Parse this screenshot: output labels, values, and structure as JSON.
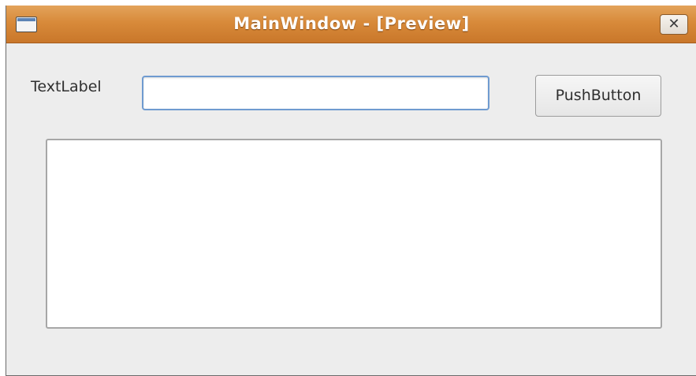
{
  "window": {
    "title": "MainWindow - [Preview]",
    "icon": "window-icon",
    "close_label": "✕",
    "colors": {
      "titlebar": "#d88a3a",
      "background": "#ededed"
    }
  },
  "form": {
    "label": "TextLabel",
    "line_edit_value": "",
    "button_label": "PushButton",
    "text_area_value": ""
  }
}
